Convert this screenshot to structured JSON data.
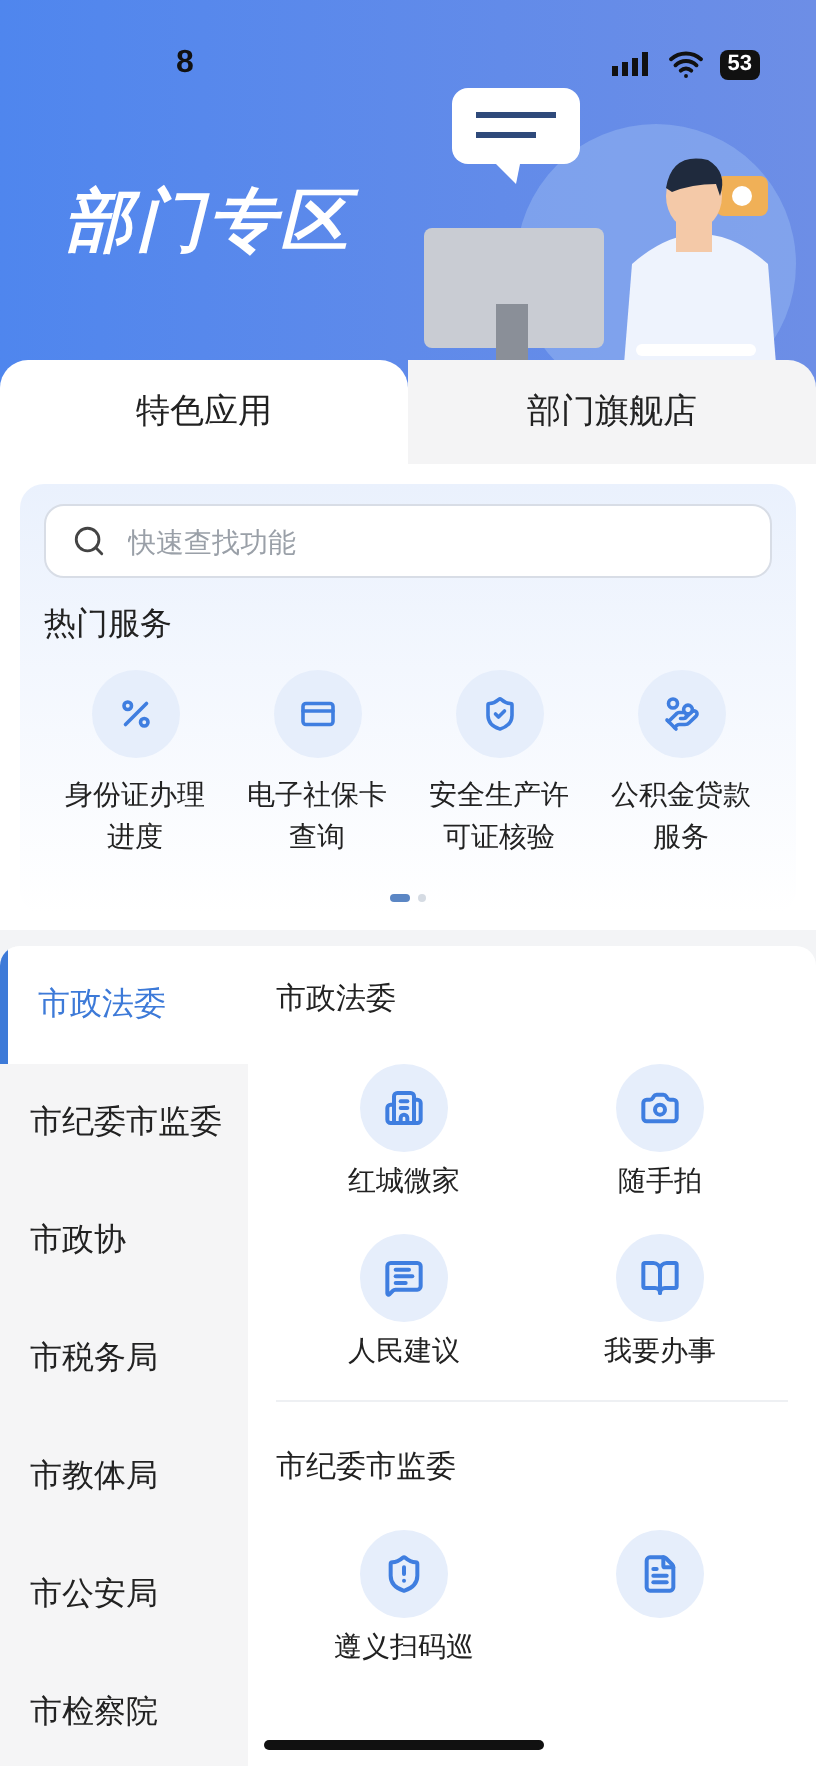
{
  "status_bar": {
    "time": "8",
    "battery": "53"
  },
  "header": {
    "title": "部门专区"
  },
  "tabs": [
    {
      "label": "特色应用",
      "selected": true
    },
    {
      "label": "部门旗舰店",
      "selected": false
    }
  ],
  "search": {
    "placeholder": "快速查找功能"
  },
  "hot_services": {
    "title": "热门服务",
    "items": [
      {
        "label": "身份证办理进度",
        "kind": "percent"
      },
      {
        "label": "电子社保卡查询",
        "kind": "card"
      },
      {
        "label": "安全生产许可证核验",
        "kind": "shield"
      },
      {
        "label": "公积金贷款服务",
        "kind": "coin"
      }
    ]
  },
  "pager": [
    {
      "selected": true
    },
    {
      "selected": false
    }
  ],
  "sidebar": {
    "items": [
      {
        "label": "市政法委",
        "selected": true
      },
      {
        "label": "市纪委市监委",
        "selected": false
      },
      {
        "label": "市政协",
        "selected": false
      },
      {
        "label": "市税务局",
        "selected": false
      },
      {
        "label": "市教体局",
        "selected": false
      },
      {
        "label": "市公安局",
        "selected": false
      },
      {
        "label": "市检察院",
        "selected": false
      }
    ]
  },
  "sections": [
    {
      "title": "市政法委",
      "items": [
        {
          "label": "红城微家",
          "kind": "building"
        },
        {
          "label": "随手拍",
          "kind": "camera"
        },
        {
          "label": "人民建议",
          "kind": "message"
        },
        {
          "label": "我要办事",
          "kind": "book"
        }
      ]
    },
    {
      "title": "市纪委市监委",
      "items": [
        {
          "label": "遵义扫码巡",
          "kind": "scan"
        },
        {
          "kind": "file"
        }
      ]
    }
  ]
}
